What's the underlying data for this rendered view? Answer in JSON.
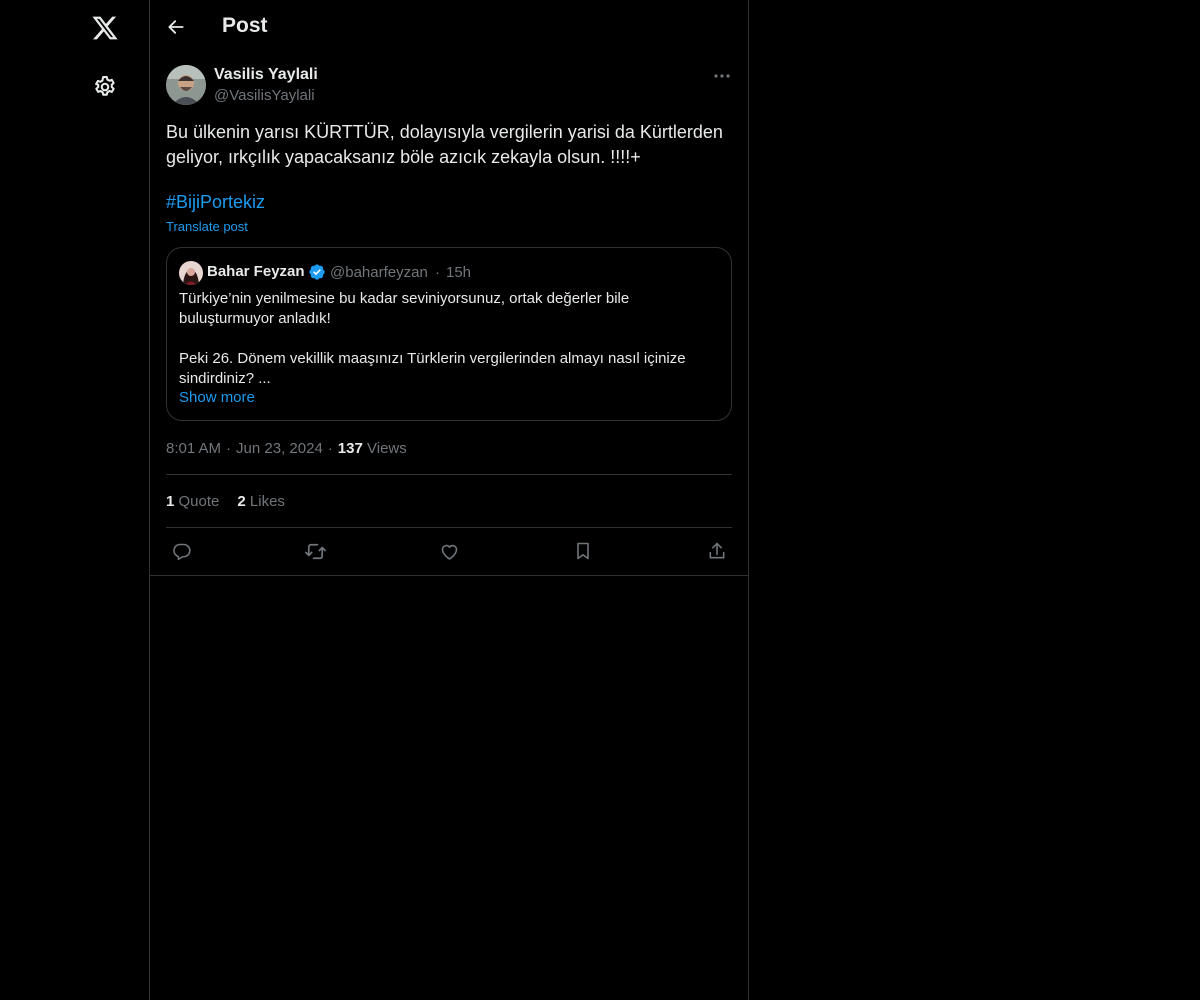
{
  "header": {
    "title": "Post"
  },
  "post": {
    "author_name": "Vasilis Yaylali",
    "author_handle": "@VasilisYaylali",
    "text_line1": "Bu ülkenin yarısı KÜRTTÜR, dolayısıyla vergilerin yarisi da Kürtlerden",
    "text_line2": "geliyor, ırkçılık yapacaksanız böle azıcık zekayla olsun. !!!!+",
    "hashtag": "#BijiPortekiz",
    "translate_label": "Translate post",
    "time": "8:01 AM",
    "date": "Jun 23, 2024",
    "views_count": "137",
    "views_label": "Views",
    "quotes_count": "1",
    "quotes_label": "Quote",
    "likes_count": "2",
    "likes_label": "Likes"
  },
  "quoted": {
    "author_name": "Bahar Feyzan",
    "author_handle": "@baharfeyzan",
    "time": "15h",
    "line1": "Türkiye’nin yenilmesine bu kadar seviniyorsunuz, ortak değerler bile",
    "line2": "buluşturmuyor anladık!",
    "line3": "Peki 26. Dönem vekillik maaşınızı Türklerin vergilerinden almayı nasıl içinize",
    "line4": "sindirdiniz? ...",
    "show_more": "Show more"
  },
  "separator": "·",
  "colors": {
    "background": "#000000",
    "text": "#e7e9ea",
    "muted": "#71767b",
    "accent": "#1d9bf0",
    "border": "#2f3336"
  },
  "icons": [
    "x-logo-icon",
    "settings-gear-icon",
    "back-arrow-icon",
    "more-dots-icon",
    "verified-badge-icon",
    "reply-icon",
    "repost-icon",
    "like-icon",
    "bookmark-icon",
    "share-icon"
  ]
}
